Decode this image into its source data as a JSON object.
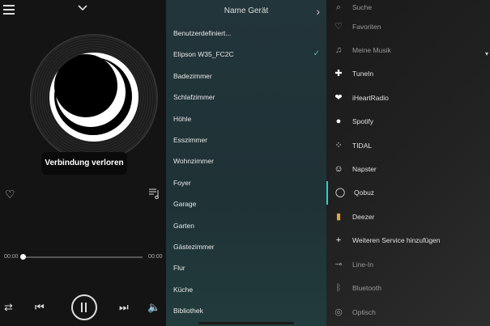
{
  "player": {
    "toast": "Verbindung verloren",
    "time_elapsed": "00:00",
    "time_total": "00:00",
    "progress": 0
  },
  "devices": {
    "header": "Name Gerät",
    "items": [
      {
        "label": "Benutzerdefiniert..."
      },
      {
        "label": "Elipson W35_FC2C",
        "selected": true
      },
      {
        "label": "Badezimmer"
      },
      {
        "label": "Schlafzimmer"
      },
      {
        "label": "Höhle"
      },
      {
        "label": "Esszimmer"
      },
      {
        "label": "Wohnzimmer"
      },
      {
        "label": "Foyer"
      },
      {
        "label": "Garage"
      },
      {
        "label": "Garten"
      },
      {
        "label": "Gästezimmer"
      },
      {
        "label": "Flur"
      },
      {
        "label": "Küche"
      },
      {
        "label": "Bibliothek"
      }
    ]
  },
  "services": {
    "items": [
      {
        "label": "Suche",
        "icon": "search-icon"
      },
      {
        "label": "Favoriten",
        "icon": "heart-icon"
      },
      {
        "label": "Meine Musik",
        "icon": "music-note-icon"
      },
      {
        "label": "TuneIn",
        "icon": "tunein-icon"
      },
      {
        "label": "iHeartRadio",
        "icon": "iheartradio-icon"
      },
      {
        "label": "Spotify",
        "icon": "spotify-icon"
      },
      {
        "label": "TIDAL",
        "icon": "tidal-icon"
      },
      {
        "label": "Napster",
        "icon": "napster-icon"
      },
      {
        "label": "Qobuz",
        "icon": "qobuz-icon",
        "active": true
      },
      {
        "label": "Deezer",
        "icon": "deezer-icon"
      },
      {
        "label": "Weiteren Service hinzufügen",
        "icon": "plus-icon"
      },
      {
        "label": "Line-In",
        "icon": "line-in-icon"
      },
      {
        "label": "Bluetooth",
        "icon": "bluetooth-icon"
      },
      {
        "label": "Optisch",
        "icon": "optical-icon"
      }
    ]
  },
  "colors": {
    "accent": "#33cccc",
    "check": "#5fb0b0"
  }
}
